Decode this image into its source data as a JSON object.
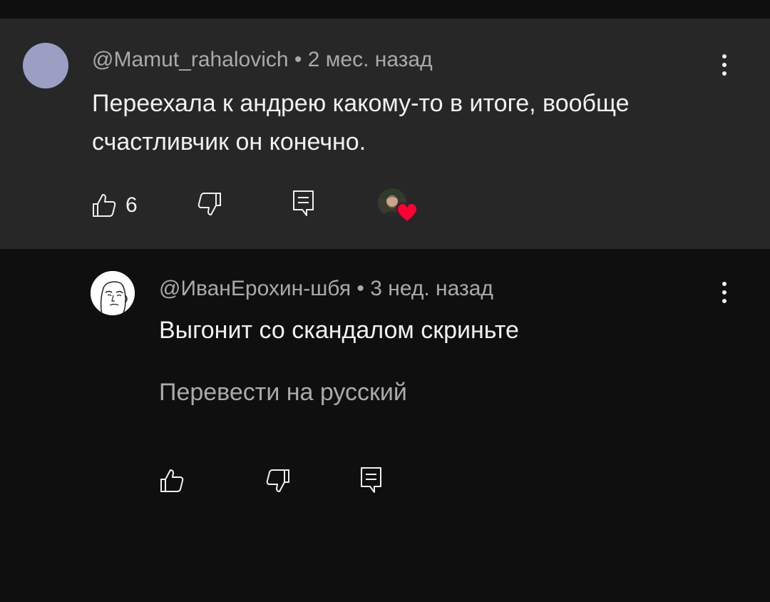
{
  "comment": {
    "author": "@Mamut_rahalovich",
    "separator": " • ",
    "time": "2 мес. назад",
    "text": "Переехала к андрею какому-то в итоге, вообще счастливчик он конечно.",
    "like_count": "6",
    "avatar_color": "#9b9fc4",
    "has_creator_heart": true
  },
  "reply": {
    "author": "@ИванЕрохин-шбя",
    "separator": " • ",
    "time": "3 нед. назад",
    "text": "Выгонит со скандалом скриньте",
    "translate_label": "Перевести на русский"
  },
  "colors": {
    "background": "#0f0f0f",
    "highlight_background": "#272727",
    "primary_text": "#f1f1f1",
    "secondary_text": "#aaaaaa",
    "heart": "#ff0033"
  },
  "icons": [
    "like-icon",
    "dislike-icon",
    "reply-icon",
    "more-options-icon",
    "heart-icon"
  ]
}
